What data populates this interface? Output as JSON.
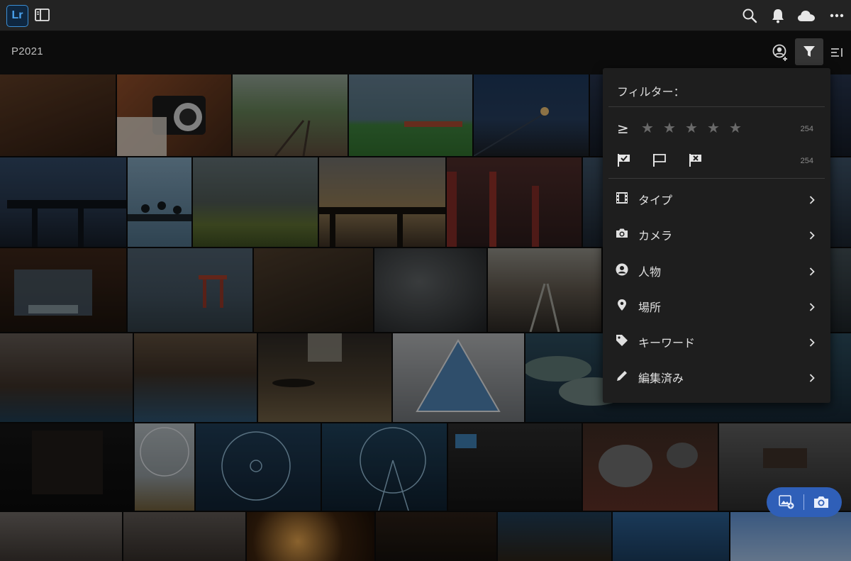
{
  "app": {
    "logo_text": "Lr"
  },
  "topbar": {
    "icons": [
      "sidebar-toggle-icon",
      "search-icon",
      "bell-icon",
      "cloud-icon",
      "more-icon"
    ]
  },
  "album": {
    "title": "P2021"
  },
  "header_icons": [
    "add-people-icon",
    "filter-icon",
    "sort-icon"
  ],
  "filter_panel": {
    "title": "フィルター：",
    "rating": {
      "operator": "≥",
      "stars": 5,
      "selected": 0,
      "count": "254"
    },
    "flags": {
      "items": [
        "picked-flag",
        "unflagged",
        "rejected-flag"
      ],
      "count": "254"
    },
    "menu": [
      {
        "label": "タイプ",
        "icon": "film-icon"
      },
      {
        "label": "カメラ",
        "icon": "camera-icon"
      },
      {
        "label": "人物",
        "icon": "person-icon"
      },
      {
        "label": "場所",
        "icon": "location-pin-icon"
      },
      {
        "label": "キーワード",
        "icon": "tag-icon"
      },
      {
        "label": "編集済み",
        "icon": "pencil-icon"
      }
    ]
  },
  "upload": {
    "icons": [
      "add-photo-icon",
      "camera-icon"
    ]
  },
  "colors": {
    "accent": "#2f5fb8",
    "topbar": "#232323",
    "panel": "#1e1e1e",
    "logo": "#0f2740"
  }
}
